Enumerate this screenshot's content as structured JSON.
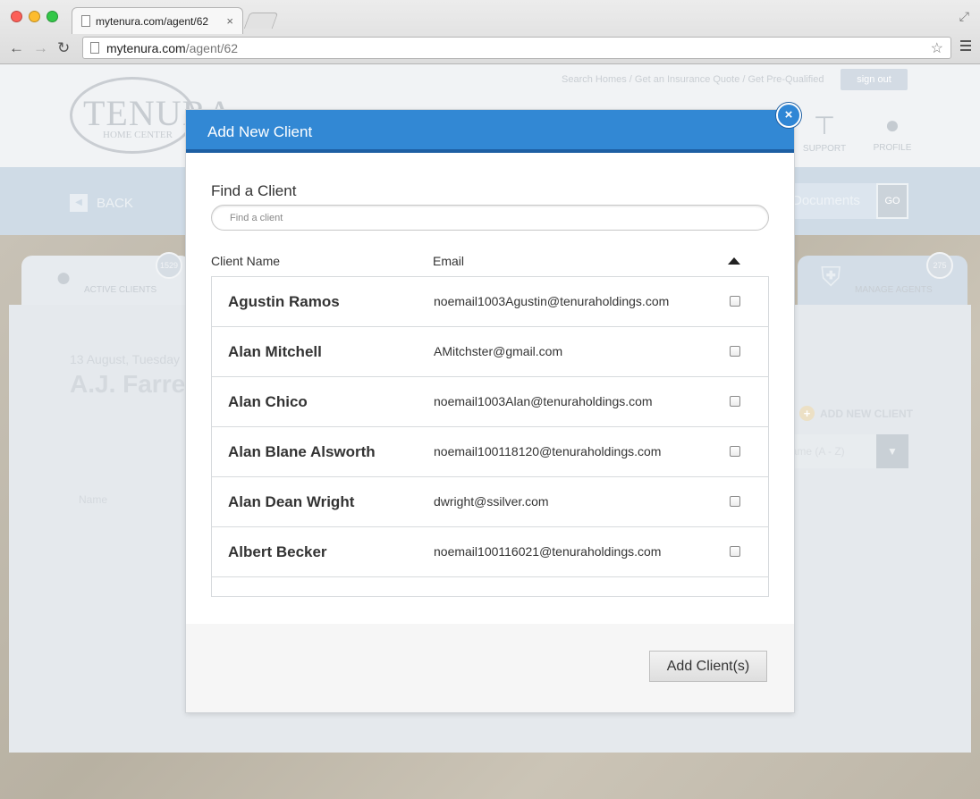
{
  "browser": {
    "tab_title": "mytenura.com/agent/62",
    "tab_close": "×",
    "url_host": "mytenura.com",
    "url_path": "/agent/62",
    "star": "☆"
  },
  "site": {
    "logo_text": "TENURA",
    "logo_sub": "HOME CENTER",
    "top_links": "Search Homes  /  Get an Insurance Quote  /  Get Pre-Qualified",
    "sign_out": "sign out",
    "support_label": "SUPPORT",
    "profile_label": "PROFILE",
    "back_label": "BACK",
    "documents_label": "Documents",
    "go_label": "GO",
    "active_clients_label": "ACTIVE CLIENTS",
    "active_clients_count": "1529",
    "manage_agents_label": "MANAGE AGENTS",
    "manage_agents_count": "275",
    "date": "13 August, Tuesday",
    "agent_name": "A.J. Farren",
    "add_new_client": "ADD NEW CLIENT",
    "sort_value": "Name (A - Z)",
    "name_column": "Name"
  },
  "modal": {
    "title": "Add New Client",
    "close_symbol": "×",
    "find_label": "Find a Client",
    "search_placeholder": "Find a client",
    "col_client_name": "Client Name",
    "col_email": "Email",
    "add_button": "Add Client(s)",
    "clients": [
      {
        "name": "Agustin Ramos",
        "email": "noemail1003Agustin@tenuraholdings.com",
        "checked": false
      },
      {
        "name": "Alan Mitchell",
        "email": "AMitchster@gmail.com",
        "checked": false
      },
      {
        "name": "Alan Chico",
        "email": "noemail1003Alan@tenuraholdings.com",
        "checked": false
      },
      {
        "name": "Alan Blane Alsworth",
        "email": "noemail100118120@tenuraholdings.com",
        "checked": false
      },
      {
        "name": "Alan Dean Wright",
        "email": "dwright@ssilver.com",
        "checked": false
      },
      {
        "name": "Albert Becker",
        "email": "noemail100116021@tenuraholdings.com",
        "checked": false
      }
    ]
  }
}
